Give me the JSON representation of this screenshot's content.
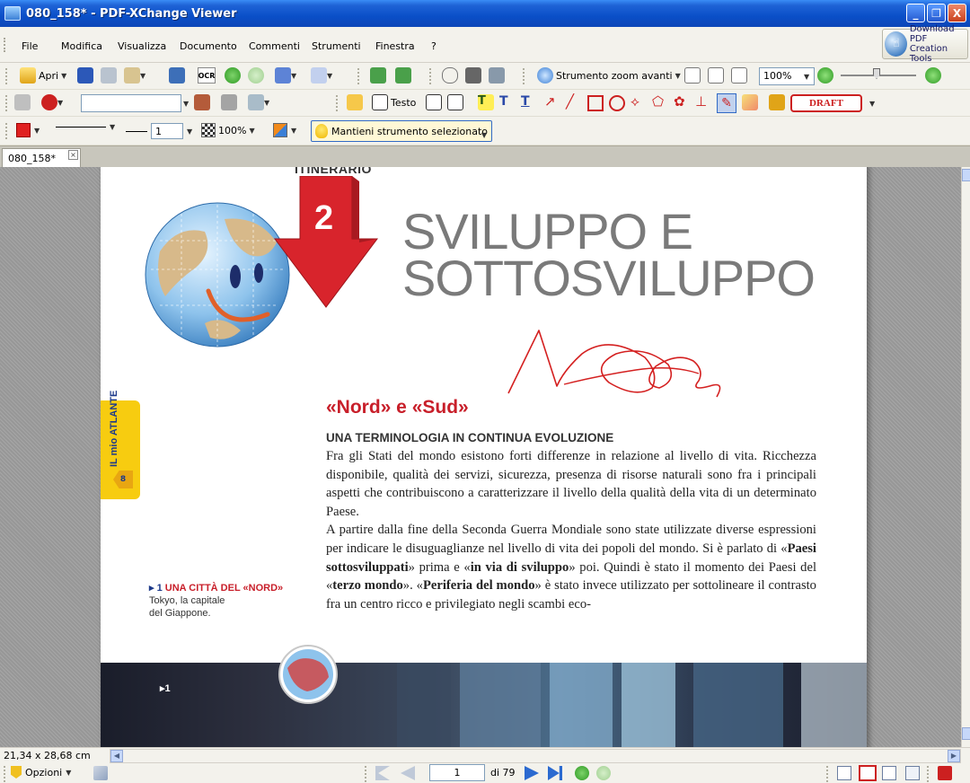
{
  "window": {
    "title": "080_158* - PDF-XChange Viewer",
    "buttons": [
      "_",
      "❐",
      "X"
    ]
  },
  "menu": {
    "items": [
      "File",
      "Modifica",
      "Visualizza",
      "Documento",
      "Commenti",
      "Strumenti",
      "Finestra",
      "?"
    ],
    "download_label_1": "Download PDF",
    "download_label_2": "Creation Tools"
  },
  "toolbar1": {
    "open_label": "Apri",
    "ocr_label": "OCR",
    "zoom_tool_label": "Strumento zoom avanti",
    "zoom_value": "100%"
  },
  "toolbar2": {
    "font_field": "",
    "text_label": "Testo",
    "draft_label": "DRAFT"
  },
  "toolbar3": {
    "line_width": "1",
    "opacity": "100%",
    "keep_tool_label": "Mantieni strumento selezionato"
  },
  "tabs": [
    {
      "label": "080_158*"
    }
  ],
  "document": {
    "kicker": "ITINERARIO",
    "chapter_number": "2",
    "headline_line1": "SVILUPPO E",
    "headline_line2": "SOTTOSVILUPPO",
    "section_title": "«Nord» e «Sud»",
    "subhead": "UNA TERMINOLOGIA IN CONTINUA EVOLUZIONE",
    "para1": "Fra gli Stati del mondo esistono forti differenze in relazione al livello di vita. Ricchezza disponibile, qualità dei servizi, sicurezza, presenza di risorse naturali sono fra i principali aspetti che contribuiscono a caratterizzare il livello della qualità della vita di un determinato Paese.",
    "para2_a": "A partire dalla fine della Seconda Guerra Mondiale sono state utilizzate diverse espressioni per indicare le disuguaglianze nel livello di vita dei popoli del mondo. Si è parlato di «",
    "para2_b1": "Paesi sottosviluppati",
    "para2_c": "» prima e «",
    "para2_b2": "in via di sviluppo",
    "para2_d": "» poi. Quindi è stato il momento dei Paesi del «",
    "para2_b3": "terzo mondo",
    "para2_e": "». «",
    "para2_b4": "Periferia del mondo",
    "para2_f": "» è stato invece utilizzato per sottolineare il contrasto fra un centro ricco e privilegiato negli scambi eco-",
    "atlante_label": "IL mio ATLANTE",
    "atlante_page": "8",
    "caption_arrow": "▸ 1",
    "caption_title": "UNA CITTÀ DEL «NORD»",
    "caption_line1": "Tokyo, la capitale",
    "caption_line2": "del Giappone.",
    "photo_label": "▸1"
  },
  "status": {
    "dimensions": "21,34 x 28,68 cm"
  },
  "navigation": {
    "options_label": "Opzioni",
    "current_page": "1",
    "page_count": "di 79"
  },
  "colors": {
    "accent_red": "#c81f2a",
    "title_blue": "#0a4fc8",
    "tab_yellow": "#f7cc10",
    "ink_annotation": "#d42020"
  }
}
